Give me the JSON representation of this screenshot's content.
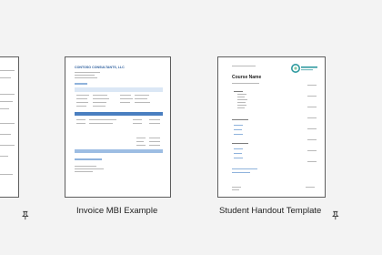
{
  "templates": [
    {
      "name": "",
      "pinnable": true
    },
    {
      "name": "Invoice MBI Example",
      "pinnable": false
    },
    {
      "name": "Student Handout Template",
      "pinnable": true
    }
  ],
  "invoice_preview": {
    "company": "CONTOSO CONSULTANTS, LLC"
  },
  "handout_preview": {
    "title": "Course Name"
  },
  "icons": {
    "pin": "pin-icon"
  },
  "colors": {
    "accent_blue": "#4a7fc0",
    "teal_logo": "#2f9aa0"
  }
}
